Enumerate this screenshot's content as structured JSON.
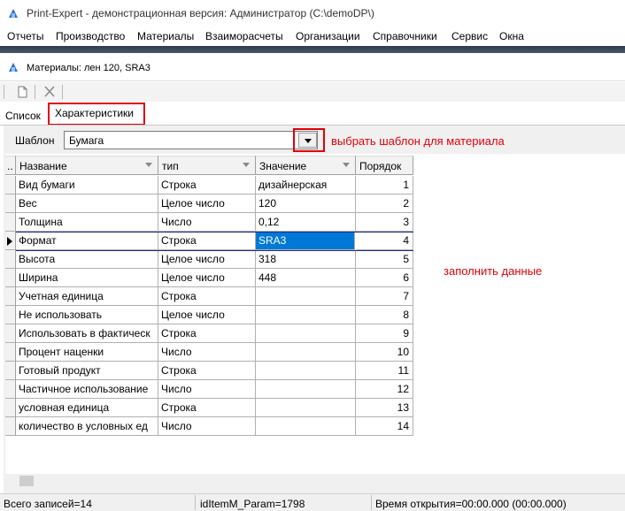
{
  "window": {
    "title": "Print-Expert - демонстрационная версия: Администратор (C:\\demoDP\\)"
  },
  "menu": [
    "Отчеты",
    "Производство",
    "Материалы",
    "Взаиморасчеты",
    "Организации",
    "Справочники",
    "Сервис",
    "Окна"
  ],
  "child": {
    "title": "Материалы: лен 120, SRA3"
  },
  "toolbar": {
    "icons": [
      "new-document-icon",
      "delete-icon"
    ]
  },
  "tabs": [
    {
      "label": "Список"
    },
    {
      "label": "Характеристики",
      "active": true
    }
  ],
  "template": {
    "label": "Шаблон",
    "value": "Бумага"
  },
  "hints": {
    "choose_template": "выбрать шаблон для материала",
    "fill_data": "заполнить данные"
  },
  "grid": {
    "columns": [
      "Название",
      "тип",
      "Значение",
      "Порядок"
    ],
    "rows": [
      [
        "Вид бумаги",
        "Строка",
        "дизайнерская",
        "1"
      ],
      [
        "Вес",
        "Целое число",
        "120",
        "2"
      ],
      [
        "Толщина",
        "Число",
        "0,12",
        "3"
      ],
      [
        "Формат",
        "Строка",
        "SRA3",
        "4"
      ],
      [
        "Высота",
        "Целое число",
        "318",
        "5"
      ],
      [
        "Ширина",
        "Целое число",
        "448",
        "6"
      ],
      [
        "Учетная единица",
        "Строка",
        "",
        "7"
      ],
      [
        "Не использовать",
        "Целое число",
        "",
        "8"
      ],
      [
        "Использовать в фактическ",
        "Строка",
        "",
        "9"
      ],
      [
        "Процент наценки",
        "Число",
        "",
        "10"
      ],
      [
        "Готовый продукт",
        "Строка",
        "",
        "11"
      ],
      [
        "Частичное использование",
        "Число",
        "",
        "12"
      ],
      [
        "условная единица",
        "Строка",
        "",
        "13"
      ],
      [
        "количество в условных ед",
        "Число",
        "",
        "14"
      ]
    ],
    "selected_row": 3
  },
  "status": {
    "records": "Всего записей=14",
    "param": "idItemM_Param=1798",
    "open_time": "Время открытия=00:00.000 (00:00.000)"
  },
  "colors": {
    "highlight_red": "#e0000a",
    "selection_blue": "#0078d7",
    "row_marker": "#1a2b8c"
  }
}
